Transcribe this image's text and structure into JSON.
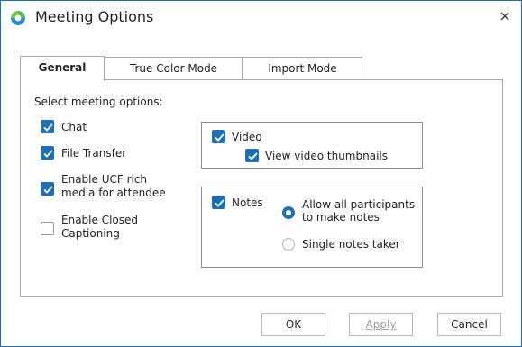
{
  "window": {
    "title": "Meeting Options"
  },
  "tabs": [
    {
      "label": "General",
      "active": true
    },
    {
      "label": "True Color Mode",
      "active": false
    },
    {
      "label": "Import Mode",
      "active": false
    }
  ],
  "general": {
    "heading": "Select meeting options:",
    "options": [
      {
        "label": "Chat",
        "checked": true
      },
      {
        "label": "File Transfer",
        "checked": true
      },
      {
        "label_line1": "Enable UCF rich",
        "label_line2": "media for attendee",
        "checked": true
      },
      {
        "label_line1": "Enable Closed",
        "label_line2": "Captioning",
        "checked": false
      }
    ],
    "video": {
      "label": "Video",
      "checked": true,
      "thumbnails_label": "View video thumbnails",
      "thumbnails_checked": true
    },
    "notes": {
      "label": "Notes",
      "checked": true,
      "radio_all_line1": "Allow all participants",
      "radio_all_line2": "to make notes",
      "radio_all_selected": true,
      "radio_single": "Single notes taker",
      "radio_single_selected": false
    }
  },
  "buttons": {
    "ok": "OK",
    "apply": "Apply",
    "cancel": "Cancel"
  },
  "colors": {
    "accent": "#1d6fb8",
    "border": "#1e6fb8"
  }
}
